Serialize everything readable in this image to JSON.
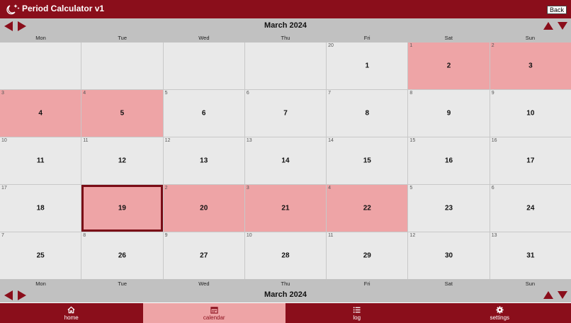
{
  "app": {
    "title": "Period Calculator v1",
    "back_label": "Back"
  },
  "calendar": {
    "month_label": "March 2024",
    "weekdays": [
      "Mon",
      "Tue",
      "Wed",
      "Thu",
      "Fri",
      "Sat",
      "Sun"
    ],
    "days": [
      {
        "day": "",
        "cycle": "",
        "period": false
      },
      {
        "day": "",
        "cycle": "",
        "period": false
      },
      {
        "day": "",
        "cycle": "",
        "period": false
      },
      {
        "day": "",
        "cycle": "",
        "period": false
      },
      {
        "day": "1",
        "cycle": "20",
        "period": false
      },
      {
        "day": "2",
        "cycle": "1",
        "period": true
      },
      {
        "day": "3",
        "cycle": "2",
        "period": true
      },
      {
        "day": "4",
        "cycle": "3",
        "period": true
      },
      {
        "day": "5",
        "cycle": "4",
        "period": true
      },
      {
        "day": "6",
        "cycle": "5",
        "period": false
      },
      {
        "day": "7",
        "cycle": "6",
        "period": false
      },
      {
        "day": "8",
        "cycle": "7",
        "period": false
      },
      {
        "day": "9",
        "cycle": "8",
        "period": false
      },
      {
        "day": "10",
        "cycle": "9",
        "period": false
      },
      {
        "day": "11",
        "cycle": "10",
        "period": false
      },
      {
        "day": "12",
        "cycle": "11",
        "period": false
      },
      {
        "day": "13",
        "cycle": "12",
        "period": false
      },
      {
        "day": "14",
        "cycle": "13",
        "period": false
      },
      {
        "day": "15",
        "cycle": "14",
        "period": false
      },
      {
        "day": "16",
        "cycle": "15",
        "period": false
      },
      {
        "day": "17",
        "cycle": "16",
        "period": false
      },
      {
        "day": "18",
        "cycle": "17",
        "period": false
      },
      {
        "day": "19",
        "cycle": "",
        "period": true,
        "today": true
      },
      {
        "day": "20",
        "cycle": "2",
        "period": true
      },
      {
        "day": "21",
        "cycle": "3",
        "period": true
      },
      {
        "day": "22",
        "cycle": "4",
        "period": true
      },
      {
        "day": "23",
        "cycle": "5",
        "period": false
      },
      {
        "day": "24",
        "cycle": "6",
        "period": false
      },
      {
        "day": "25",
        "cycle": "7",
        "period": false
      },
      {
        "day": "26",
        "cycle": "8",
        "period": false
      },
      {
        "day": "27",
        "cycle": "9",
        "period": false
      },
      {
        "day": "28",
        "cycle": "10",
        "period": false
      },
      {
        "day": "29",
        "cycle": "11",
        "period": false
      },
      {
        "day": "30",
        "cycle": "12",
        "period": false
      },
      {
        "day": "31",
        "cycle": "13",
        "period": false
      }
    ]
  },
  "tabs": [
    {
      "label": "home",
      "icon": "home-icon",
      "active": false
    },
    {
      "label": "calendar",
      "icon": "calendar-icon",
      "active": true
    },
    {
      "label": "log",
      "icon": "list-icon",
      "active": false
    },
    {
      "label": "settings",
      "icon": "gear-icon",
      "active": false
    }
  ],
  "colors": {
    "primary": "#8a0e1b",
    "period": "#eea4a6",
    "cell": "#e9e9e9",
    "bar": "#c1c1c1"
  }
}
